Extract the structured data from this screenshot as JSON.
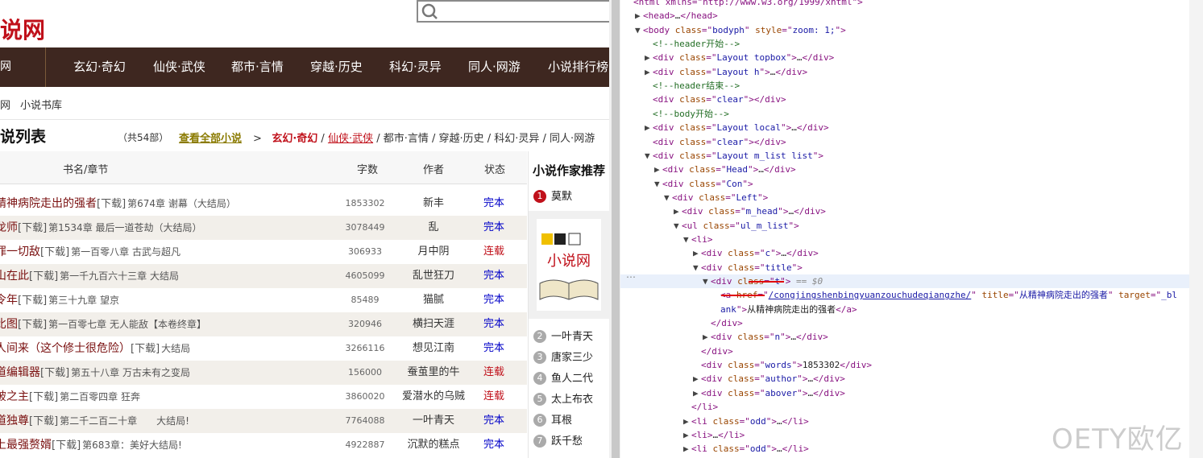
{
  "site": {
    "logo_text": "说网",
    "nav_home": "网",
    "nav_items": [
      "玄幻·奇幻",
      "仙侠·武侠",
      "都市·言情",
      "穿越·历史",
      "科幻·灵异",
      "同人·网游",
      "小说排行榜"
    ],
    "breadcrumb": [
      "网",
      "小说书库"
    ],
    "list_title": "说列表",
    "count": "（共54部）",
    "view_all": "查看全部小说",
    "cat_arrow": ">",
    "cat_active": "玄幻·奇幻",
    "cat_sep": "/",
    "cat_underlined": "仙侠·武侠",
    "cat_rest": "/ 都市·言情 / 穿越·历史 / 科幻·灵异 / 同人·网游",
    "headers": {
      "name": "书名/章节",
      "words": "字数",
      "author": "作者",
      "status": "状态"
    },
    "rows": [
      {
        "name": "精神病院走出的强者",
        "dl": "[下载]",
        "chapter": "第674章 谢幕（大结局）",
        "words": "1853302",
        "author": "新丰",
        "status": "完本",
        "done": true
      },
      {
        "name": "龙师",
        "dl": "[下载]",
        "chapter": "第1534章 最后一道苍劫（大结局）",
        "words": "3078449",
        "author": "乱",
        "status": "完本",
        "done": true
      },
      {
        "name": "罪一切敌",
        "dl": "[下载]",
        "chapter": "第一百零八章 古武与超凡",
        "words": "306933",
        "author": "月中阴",
        "status": "连载",
        "done": false
      },
      {
        "name": "山在此",
        "dl": "[下载]",
        "chapter": "第一千九百六十三章 大结局",
        "words": "4605099",
        "author": "乱世狂刀",
        "status": "完本",
        "done": true
      },
      {
        "name": "令年",
        "dl": "[下载]",
        "chapter": "第三十九章 望京",
        "words": "85489",
        "author": "猫腻",
        "status": "完本",
        "done": true
      },
      {
        "name": "比图",
        "dl": "[下载]",
        "chapter": "第一百零七章 无人能敌【本卷终章】",
        "words": "320946",
        "author": "横扫天涯",
        "status": "完本",
        "done": true
      },
      {
        "name": "人间来（这个修士很危险）",
        "dl": "[下载]",
        "chapter": "大结局",
        "words": "3266116",
        "author": "想见江南",
        "status": "完本",
        "done": true
      },
      {
        "name": "道编辑器",
        "dl": "[下载]",
        "chapter": "第五十八章 万古未有之变局",
        "words": "156000",
        "author": "蚕茧里的牛",
        "status": "连载",
        "done": false
      },
      {
        "name": "破之主",
        "dl": "[下载]",
        "chapter": "第二百零四章 狂奔",
        "words": "3860020",
        "author": "爱潜水的乌贼",
        "status": "连载",
        "done": false
      },
      {
        "name": "道独尊",
        "dl": "[下载]",
        "chapter": "第二千二百二十章　　大结局!",
        "words": "7764088",
        "author": "一叶青天",
        "status": "完本",
        "done": true
      },
      {
        "name": "上最强赘婿",
        "dl": "[下载]",
        "chapter": "第683章：美好大结局!",
        "words": "4922887",
        "author": "沉默的糕点",
        "status": "完本",
        "done": true
      }
    ],
    "side": {
      "title": "小说作家推荐",
      "first_rank": "1",
      "first_author": "莫默",
      "ranked": [
        {
          "n": "2",
          "name": "一叶青天"
        },
        {
          "n": "3",
          "name": "唐家三少"
        },
        {
          "n": "4",
          "name": "鱼人二代"
        },
        {
          "n": "5",
          "name": "太上布衣"
        },
        {
          "n": "6",
          "name": "耳根"
        },
        {
          "n": "7",
          "name": "跃千愁"
        }
      ],
      "img_text": "小说网"
    }
  },
  "devtools": {
    "lines": [
      {
        "t": "top",
        "indent": 0,
        "tri": "",
        "html": "<span class='tag'>&lt;html xmlns=\"http://www.w3.org/1999/xhtml\"&gt;</span>"
      },
      {
        "indent": 1,
        "tri": "▶",
        "html": "<span class='tag'>&lt;head&gt;</span><span class='txt'>…</span><span class='tag'>&lt;/head&gt;</span>"
      },
      {
        "indent": 1,
        "tri": "▼",
        "html": "<span class='tag'>&lt;body </span><span class='attr'>class</span><span class='tag'>=\"</span><span class='val'>bodyph</span><span class='tag'>\" </span><span class='attr'>style</span><span class='tag'>=\"</span><span class='val'>zoom: 1;</span><span class='tag'>\"&gt;</span>"
      },
      {
        "indent": 2,
        "tri": "",
        "html": "<span class='cm'>&lt;!--header开始--&gt;</span>"
      },
      {
        "indent": 2,
        "tri": "▶",
        "html": "<span class='tag'>&lt;div </span><span class='attr'>class</span><span class='tag'>=\"</span><span class='val'>Layout topbox</span><span class='tag'>\"&gt;</span><span class='txt'>…</span><span class='tag'>&lt;/div&gt;</span>"
      },
      {
        "indent": 2,
        "tri": "▶",
        "html": "<span class='tag'>&lt;div </span><span class='attr'>class</span><span class='tag'>=\"</span><span class='val'>Layout h</span><span class='tag'>\"&gt;</span><span class='txt'>…</span><span class='tag'>&lt;/div&gt;</span>"
      },
      {
        "indent": 2,
        "tri": "",
        "html": "<span class='cm'>&lt;!--header结束--&gt;</span>"
      },
      {
        "indent": 2,
        "tri": "",
        "html": "<span class='tag'>&lt;div </span><span class='attr'>class</span><span class='tag'>=\"</span><span class='val'>clear</span><span class='tag'>\"&gt;&lt;/div&gt;</span>"
      },
      {
        "indent": 2,
        "tri": "",
        "html": "<span class='cm'>&lt;!--body开始--&gt;</span>"
      },
      {
        "indent": 2,
        "tri": "▶",
        "html": "<span class='tag'>&lt;div </span><span class='attr'>class</span><span class='tag'>=\"</span><span class='val'>Layout local</span><span class='tag'>\"&gt;</span><span class='txt'>…</span><span class='tag'>&lt;/div&gt;</span>"
      },
      {
        "indent": 2,
        "tri": "",
        "html": "<span class='tag'>&lt;div </span><span class='attr'>class</span><span class='tag'>=\"</span><span class='val'>clear</span><span class='tag'>\"&gt;&lt;/div&gt;</span>"
      },
      {
        "indent": 2,
        "tri": "▼",
        "html": "<span class='tag'>&lt;div </span><span class='attr'>class</span><span class='tag'>=\"</span><span class='val'>Layout m_list list</span><span class='tag'>\"&gt;</span>"
      },
      {
        "indent": 3,
        "tri": "▶",
        "html": "<span class='tag'>&lt;div </span><span class='attr'>class</span><span class='tag'>=\"</span><span class='val'>Head</span><span class='tag'>\"&gt;</span><span class='txt'>…</span><span class='tag'>&lt;/div&gt;</span>"
      },
      {
        "indent": 3,
        "tri": "▼",
        "html": "<span class='tag'>&lt;div </span><span class='attr'>class</span><span class='tag'>=\"</span><span class='val'>Con</span><span class='tag'>\"&gt;</span>"
      },
      {
        "indent": 4,
        "tri": "▼",
        "html": "<span class='tag'>&lt;div </span><span class='attr'>class</span><span class='tag'>=\"</span><span class='val'>Left</span><span class='tag'>\"&gt;</span>"
      },
      {
        "indent": 5,
        "tri": "▶",
        "html": "<span class='tag'>&lt;div </span><span class='attr'>class</span><span class='tag'>=\"</span><span class='val'>m_head</span><span class='tag'>\"&gt;</span><span class='txt'>…</span><span class='tag'>&lt;/div&gt;</span>"
      },
      {
        "indent": 5,
        "tri": "▼",
        "html": "<span class='tag'>&lt;ul </span><span class='attr'>class</span><span class='tag'>=\"</span><span class='val'>ul_m_list</span><span class='tag'>\"&gt;</span>"
      },
      {
        "indent": 6,
        "tri": "▼",
        "html": "<span class='tag'>&lt;li&gt;</span>"
      },
      {
        "indent": 7,
        "tri": "▶",
        "html": "<span class='tag'>&lt;div </span><span class='attr'>class</span><span class='tag'>=\"</span><span class='val'>c</span><span class='tag'>\"&gt;</span><span class='txt'>…</span><span class='tag'>&lt;/div&gt;</span>"
      },
      {
        "indent": 7,
        "tri": "▼",
        "html": "<span class='tag'>&lt;div </span><span class='attr'>class</span><span class='tag'>=\"</span><span class='val'>title</span><span class='tag'>\"&gt;</span>"
      },
      {
        "indent": 8,
        "tri": "▼",
        "sel": true,
        "html": "<span class='tag'>&lt;div </span><span class='attr'>class</span><span class='tag'>=\"</span><span class='val'>t</span><span class='tag'>\"&gt;</span><span class='dim'> == $0</span>"
      },
      {
        "indent": 9,
        "tri": "",
        "html": "<span class='tag'>&lt;a </span><span class='attr'>href</span><span class='tag'>=\"</span><span class='link'>/congjingshenbingyuanzouchudeqiangzhe/</span><span class='tag'>\" </span><span class='attr'>title</span><span class='tag'>=\"</span><span class='val'>从精神病院走出的强者</span><span class='tag'>\" </span><span class='attr'>target</span><span class='tag'>=\"</span><span class='val'>_bl</span>"
      },
      {
        "indent": 9,
        "tri": "",
        "html": "<span class='val'>ank</span><span class='tag'>\"&gt;</span><span class='txt'>从精神病院走出的强者</span><span class='tag'>&lt;/a&gt;</span>"
      },
      {
        "indent": 8,
        "tri": "",
        "html": "<span class='tag'>&lt;/div&gt;</span>"
      },
      {
        "indent": 8,
        "tri": "▶",
        "html": "<span class='tag'>&lt;div </span><span class='attr'>class</span><span class='tag'>=\"</span><span class='val'>n</span><span class='tag'>\"&gt;</span><span class='txt'>…</span><span class='tag'>&lt;/div&gt;</span>"
      },
      {
        "indent": 7,
        "tri": "",
        "html": "<span class='tag'>&lt;/div&gt;</span>"
      },
      {
        "indent": 7,
        "tri": "",
        "html": "<span class='tag'>&lt;div </span><span class='attr'>class</span><span class='tag'>=\"</span><span class='val'>words</span><span class='tag'>\"&gt;</span><span class='txt'>1853302</span><span class='tag'>&lt;/div&gt;</span>"
      },
      {
        "indent": 7,
        "tri": "▶",
        "html": "<span class='tag'>&lt;div </span><span class='attr'>class</span><span class='tag'>=\"</span><span class='val'>author</span><span class='tag'>\"&gt;</span><span class='txt'>…</span><span class='tag'>&lt;/div&gt;</span>"
      },
      {
        "indent": 7,
        "tri": "▶",
        "html": "<span class='tag'>&lt;div </span><span class='attr'>class</span><span class='tag'>=\"</span><span class='val'>abover</span><span class='tag'>\"&gt;</span><span class='txt'>…</span><span class='tag'>&lt;/div&gt;</span>"
      },
      {
        "indent": 6,
        "tri": "",
        "html": "<span class='tag'>&lt;/li&gt;</span>"
      },
      {
        "indent": 6,
        "tri": "▶",
        "html": "<span class='tag'>&lt;li </span><span class='attr'>class</span><span class='tag'>=\"</span><span class='val'>odd</span><span class='tag'>\"&gt;</span><span class='txt'>…</span><span class='tag'>&lt;/li&gt;</span>"
      },
      {
        "indent": 6,
        "tri": "▶",
        "html": "<span class='tag'>&lt;li&gt;</span><span class='txt'>…</span><span class='tag'>&lt;/li&gt;</span>"
      },
      {
        "indent": 6,
        "tri": "▶",
        "html": "<span class='tag'>&lt;li </span><span class='attr'>class</span><span class='tag'>=\"</span><span class='val'>odd</span><span class='tag'>\"&gt;</span><span class='txt'>…</span><span class='tag'>&lt;/li&gt;</span>"
      },
      {
        "indent": 6,
        "tri": "▶",
        "html": "<span class='tag'>&lt;li&gt;</span><span class='txt'>…</span><span class='tag'>&lt;/li&gt;</span>"
      }
    ],
    "ellipsis": "…",
    "watermark": "OETY欧亿"
  }
}
